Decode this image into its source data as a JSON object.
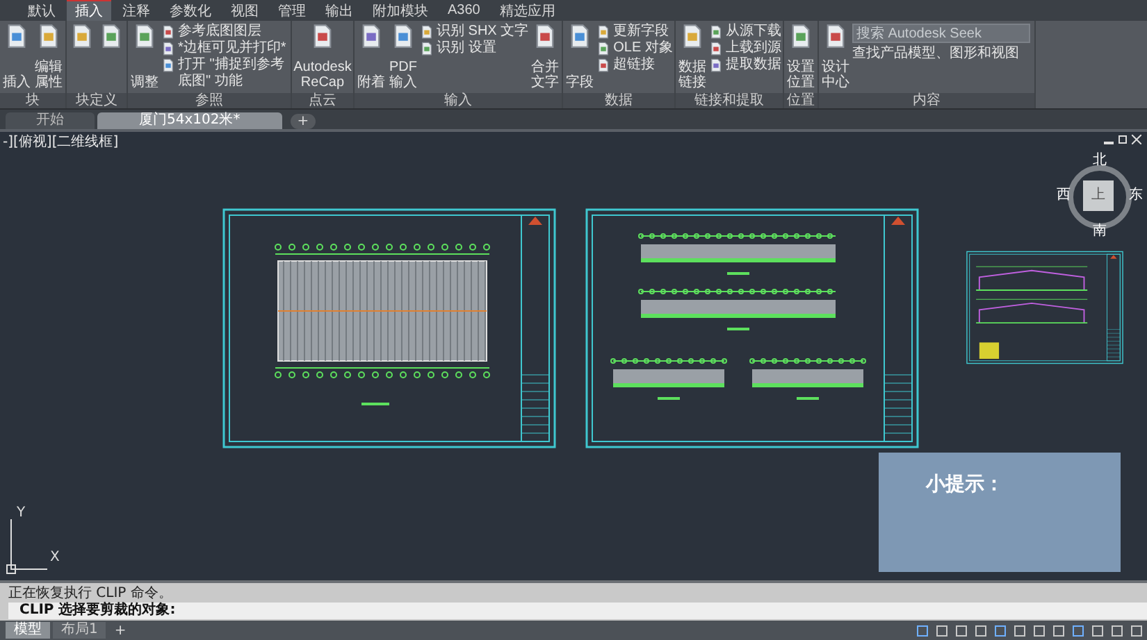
{
  "ribbon": {
    "tabs": [
      {
        "label": "默认",
        "selected": false
      },
      {
        "label": "插入",
        "selected": true
      },
      {
        "label": "注释",
        "selected": false
      },
      {
        "label": "参数化",
        "selected": false
      },
      {
        "label": "视图",
        "selected": false
      },
      {
        "label": "管理",
        "selected": false
      },
      {
        "label": "输出",
        "selected": false
      },
      {
        "label": "附加模块",
        "selected": false
      },
      {
        "label": "A360",
        "selected": false
      },
      {
        "label": "精选应用",
        "selected": false
      }
    ],
    "panels": [
      {
        "title": "块",
        "items": [
          {
            "kind": "large",
            "label": "插入"
          },
          {
            "kind": "large",
            "label": "编辑属性"
          }
        ]
      },
      {
        "title": "块定义",
        "items": [
          {
            "kind": "icon"
          },
          {
            "kind": "icon"
          }
        ]
      },
      {
        "title": "参照",
        "items": [
          {
            "kind": "large",
            "label": "调整"
          },
          {
            "kind": "small",
            "label": "参考底图图层"
          },
          {
            "kind": "small",
            "label": "*边框可见并打印*"
          },
          {
            "kind": "small",
            "label": "打开 \"捕捉到参考底图\" 功能"
          }
        ]
      },
      {
        "title": "点云",
        "items": [
          {
            "kind": "large",
            "label": "Autodesk ReCap"
          }
        ]
      },
      {
        "title": "输入",
        "items": [
          {
            "kind": "large",
            "label": "附着"
          },
          {
            "kind": "large",
            "label": "PDF 输入"
          },
          {
            "kind": "small",
            "label": "识别 SHX 文字"
          },
          {
            "kind": "small",
            "label": "识别 设置"
          },
          {
            "kind": "large",
            "label": "合并文字"
          }
        ]
      },
      {
        "title": "数据",
        "items": [
          {
            "kind": "large",
            "label": "字段"
          },
          {
            "kind": "small",
            "label": "更新字段"
          },
          {
            "kind": "small",
            "label": "OLE 对象"
          },
          {
            "kind": "small",
            "label": "超链接"
          }
        ]
      },
      {
        "title": "链接和提取",
        "items": [
          {
            "kind": "large",
            "label": "数据链接"
          },
          {
            "kind": "small",
            "label": "从源下载"
          },
          {
            "kind": "small",
            "label": "上载到源"
          },
          {
            "kind": "small",
            "label": "提取数据"
          }
        ]
      },
      {
        "title": "位置",
        "items": [
          {
            "kind": "large",
            "label": "设置位置"
          }
        ]
      },
      {
        "title": "内容",
        "items": [
          {
            "kind": "large",
            "label": "设计中心"
          },
          {
            "kind": "search",
            "placeholder": "搜索 Autodesk Seek",
            "label": "查找产品模型、图形和视图"
          }
        ]
      }
    ]
  },
  "doc_tabs": [
    {
      "label": "开始",
      "selected": false
    },
    {
      "label": "厦门54x102米*",
      "selected": true
    }
  ],
  "new_tab": "+",
  "viewport": {
    "label": "-][俯视][二维线框]",
    "sheets": [
      {
        "kind": "plan"
      },
      {
        "kind": "elevations"
      },
      {
        "kind": "section"
      }
    ],
    "viewcube": {
      "north": "北",
      "west": "西",
      "east": "东",
      "south": "南",
      "top": "上"
    },
    "ucs": {
      "x": "X",
      "y": "Y"
    },
    "tip": "小提示："
  },
  "command_line": [
    {
      "kind": "history",
      "text": "正在恢复执行 CLIP 命令。"
    },
    {
      "kind": "prompt",
      "text": "CLIP 选择要剪裁的对象:"
    }
  ],
  "status_bar": {
    "tabs": [
      {
        "label": "模型",
        "selected": true
      },
      {
        "label": "布局1",
        "selected": false
      }
    ],
    "add": "+"
  }
}
